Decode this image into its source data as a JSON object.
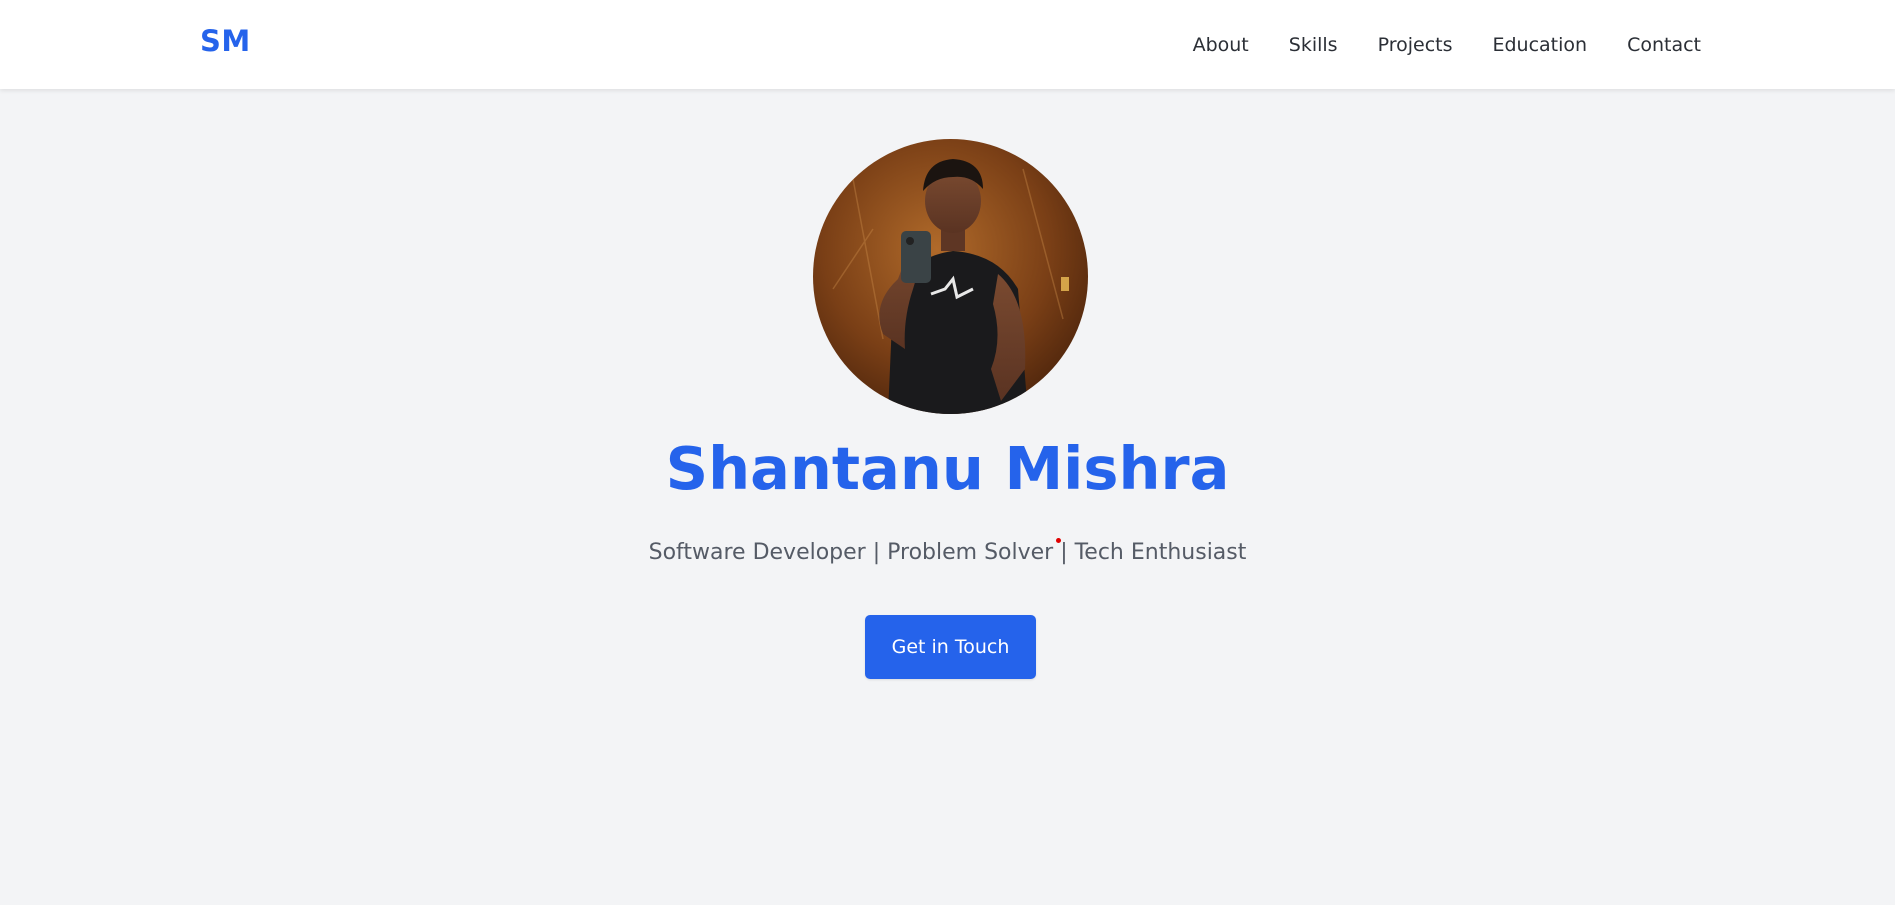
{
  "header": {
    "logo": "SM",
    "nav": [
      {
        "label": "About"
      },
      {
        "label": "Skills"
      },
      {
        "label": "Projects"
      },
      {
        "label": "Education"
      },
      {
        "label": "Contact"
      }
    ]
  },
  "hero": {
    "name": "Shantanu Mishra",
    "tagline": "Software Developer | Problem Solver | Tech Enthusiast",
    "cta_label": "Get in Touch",
    "avatar": "profile-photo"
  },
  "colors": {
    "accent": "#2563eb",
    "background": "#f3f4f6",
    "nav_text": "#2b2f36",
    "tagline_text": "#555b66"
  }
}
